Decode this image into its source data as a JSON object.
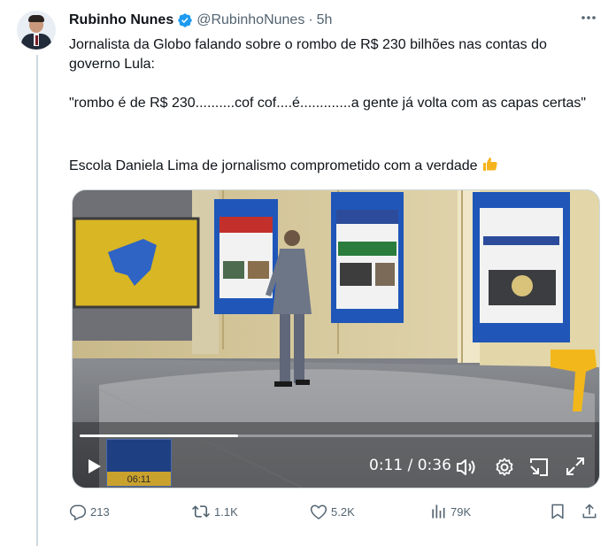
{
  "author": {
    "name": "Rubinho Nunes",
    "handle": "@RubinhoNunes",
    "separator": "·",
    "time": "5h",
    "verified": true
  },
  "tweet": {
    "line1": "Jornalista da Globo falando sobre o rombo de R$ 230 bilhões nas contas do governo Lula:",
    "line2": "\"rombo é de R$ 230..........cof cof....é.............a gente já volta com as capas certas\"",
    "line3": "Escola Daniela Lima de jornalismo comprometido com a verdade"
  },
  "video": {
    "elapsed": "0:11",
    "duration": "0:36",
    "time_display": "0:11 / 0:36",
    "progress": 0.31,
    "thumbnail_time": "06:11",
    "newspaper_center": "MAIS DE 1,4 MIL CHANCES NO ESTADO",
    "newspaper_right": "Pioneiro",
    "newspaper_right_headline": "Número de homicídios tem crescimento de 42% na Serra"
  },
  "actions": {
    "replies": "213",
    "reposts": "1.1K",
    "likes": "5.2K",
    "views": "79K"
  },
  "colors": {
    "verified": "#1d9bf0",
    "muted_text": "#536471",
    "thumbs_up": "#f5b41c"
  },
  "icons": {
    "more": "more-icon",
    "reply": "reply-icon",
    "repost": "repost-icon",
    "like": "heart-icon",
    "views": "views-icon",
    "bookmark": "bookmark-icon",
    "share": "share-icon"
  }
}
